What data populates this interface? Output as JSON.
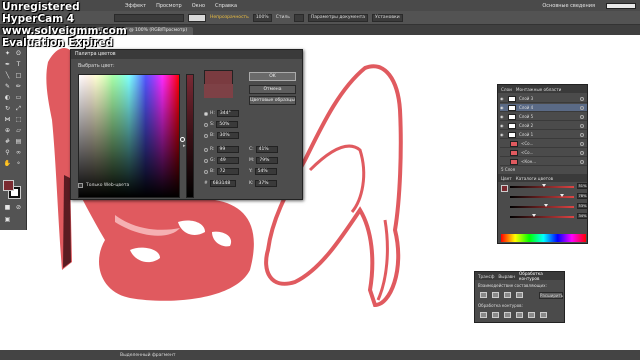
{
  "watermark": {
    "line1": "Unregistered HyperCam 4",
    "line2": "www.solveigmm.com",
    "line3": "Evaluation Expired"
  },
  "menubar": {
    "items": [
      "Эффект",
      "Просмотр",
      "Окно",
      "Справка"
    ],
    "workspace": "Основные сведения"
  },
  "controlbar": {
    "opacity_label": "Непрозрачность",
    "opacity_value": "100%",
    "style_label": "Стиль",
    "document_settings": "Параметры документа",
    "preferences": "Установки"
  },
  "document_tab": {
    "label": "11c3e0bcbe2b45c38241aad7cb183.jpg* @ 100% (RGB/Просмотр)"
  },
  "color_picker": {
    "title": "Палитра цветов",
    "subtitle": "Выбрать цвет:",
    "ok_label": "OK",
    "cancel_label": "Отмена",
    "swatches_label": "Цветовые образцы",
    "web_only_label": "Только Web-цвета",
    "fields": {
      "H": "344°",
      "S": "50%",
      "B": "30%",
      "R": "99",
      "G": "49",
      "B2": "72",
      "hex": "6B3148",
      "C": "41%",
      "M": "79%",
      "Y": "54%",
      "K": "37%"
    },
    "current_color": "#7a3b40",
    "previous_color": "#7e4146"
  },
  "layers_panel": {
    "tabs": [
      "Слои",
      "Монтажные области"
    ],
    "layers": [
      "Слой 3",
      "Слой 4",
      "Слой 5",
      "Слой 2",
      "Слой 1"
    ],
    "sublayers": [
      "<Со...",
      "<Со...",
      "<Кон..."
    ],
    "footer": "5 Слоя"
  },
  "color_panel": {
    "tabs": [
      "Цвет",
      "Каталоги цветов"
    ],
    "channel_values": [
      "51%",
      "78%",
      "53%",
      "34%"
    ]
  },
  "pathfinder": {
    "tabs": [
      "Трансф",
      "Выравн",
      "Обработка контуров"
    ],
    "shape_modes_label": "Взаимодействие составляющих:",
    "pathfinders_label": "Обработка контуров:",
    "apply_label": "Расширить"
  },
  "status": {
    "text": "Выделенный фрагмент"
  },
  "colors": {
    "fill": "#7a2a30",
    "shoe_red": "#e05a5f",
    "ui_dark": "#535353"
  }
}
